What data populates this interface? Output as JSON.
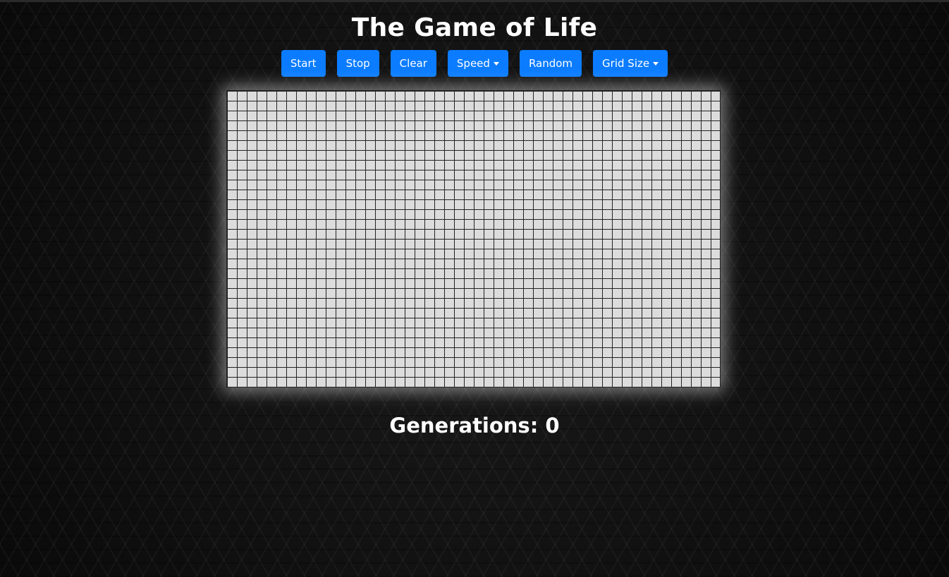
{
  "page": {
    "title": "The Game of Life"
  },
  "toolbar": {
    "start_label": "Start",
    "stop_label": "Stop",
    "clear_label": "Clear",
    "speed_label": "Speed",
    "random_label": "Random",
    "grid_size_label": "Grid Size"
  },
  "board": {
    "columns": 50,
    "rows": 30,
    "live_cells": 0,
    "cell_color_dead": "#dcdcdc",
    "grid_line_color": "#222222"
  },
  "status": {
    "generations_label": "Generations:",
    "generations_value": "0"
  },
  "colors": {
    "accent": "#0b7cff",
    "background": "#0c0c0c",
    "text": "#ffffff"
  }
}
